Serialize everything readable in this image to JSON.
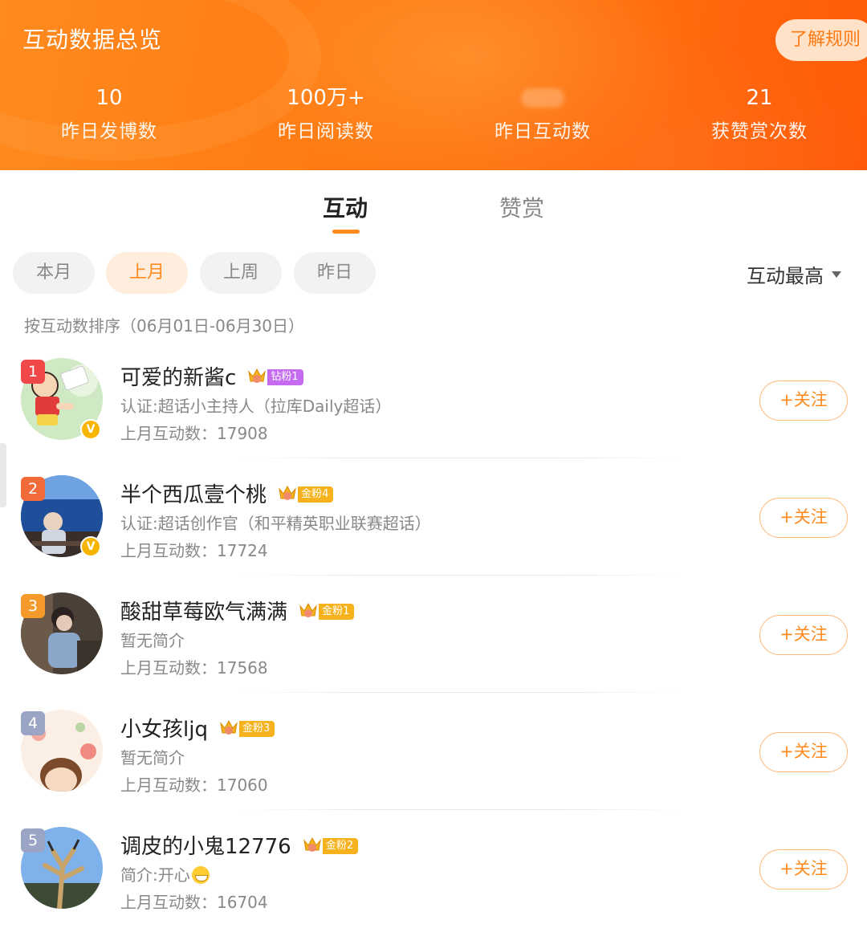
{
  "header": {
    "title": "互动数据总览",
    "rules_button": "了解规则",
    "stats": [
      {
        "value": "10",
        "label": "昨日发博数"
      },
      {
        "value": "100万+",
        "label": "昨日阅读数"
      },
      {
        "value": "",
        "label": "昨日互动数"
      },
      {
        "value": "21",
        "label": "获赞赏次数"
      }
    ]
  },
  "tabs": [
    {
      "label": "互动",
      "active": true
    },
    {
      "label": "赞赏",
      "active": false
    }
  ],
  "filters": {
    "chips": [
      {
        "label": "本月",
        "active": false
      },
      {
        "label": "上月",
        "active": true
      },
      {
        "label": "上周",
        "active": false
      },
      {
        "label": "昨日",
        "active": false
      }
    ],
    "sort_label": "互动最高",
    "sort_description": "按互动数排序（06月01日-06月30日）"
  },
  "colors": {
    "accent": "#ff8a1e",
    "rank1": "#f04848",
    "rank2": "#f26a3a",
    "rank3": "#f59a2a",
    "rank_other": "#9aa4c4",
    "diamond_badge": "#c56bf0",
    "gold_badge": "#f5b21d"
  },
  "follow_label": "+关注",
  "users": [
    {
      "rank": "1",
      "name": "可爱的新酱c",
      "badge": "钻粉1",
      "badge_type": "diamond",
      "verified": true,
      "desc": "认证:超话小主持人（拉库Daily超话）",
      "count": "上月互动数：17908",
      "avatar": "cartoon-avatar"
    },
    {
      "rank": "2",
      "name": "半个西瓜壹个桃",
      "badge": "金粉4",
      "badge_type": "gold",
      "verified": true,
      "desc": "认证:超话创作官（和平精英职业联赛超话）",
      "count": "上月互动数：17724",
      "avatar": "sea-avatar"
    },
    {
      "rank": "3",
      "name": "酸甜草莓欧气满满",
      "badge": "金粉1",
      "badge_type": "gold",
      "verified": false,
      "desc": "暂无简介",
      "count": "上月互动数：17568",
      "avatar": "person-avatar"
    },
    {
      "rank": "4",
      "name": "小女孩ljq",
      "badge": "金粉3",
      "badge_type": "gold",
      "verified": false,
      "desc": "暂无简介",
      "count": "上月互动数：17060",
      "avatar": "girl-avatar"
    },
    {
      "rank": "5",
      "name": "调皮的小鬼12776",
      "badge": "金粉2",
      "badge_type": "gold",
      "verified": false,
      "desc": "简介:开心",
      "count": "上月互动数：16704",
      "avatar": "tree-avatar",
      "desc_emoji": "grin-emoji"
    }
  ]
}
